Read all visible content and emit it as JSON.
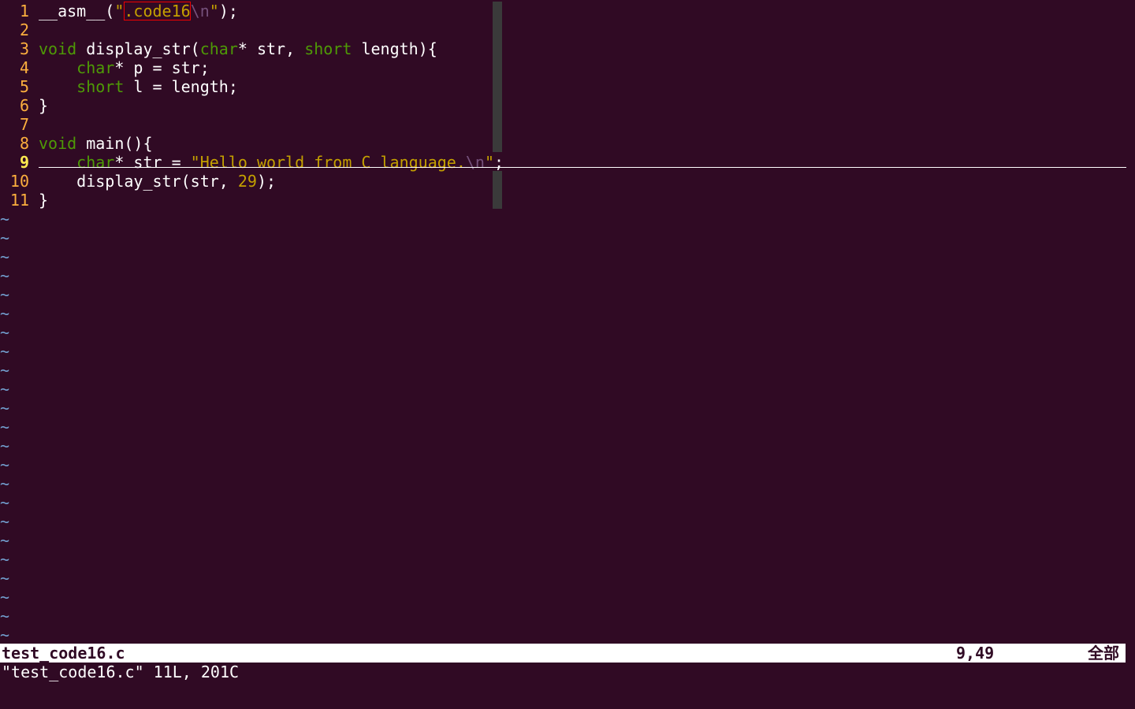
{
  "colors": {
    "background": "#300a24",
    "line_number": "#fcaf3e",
    "keyword": "#4e9a06",
    "string": "#c4a000",
    "escape": "#75507b",
    "tilde": "#729fcf",
    "statusbar_bg": "#ffffff"
  },
  "lines": [
    {
      "n": "1",
      "segs": [
        {
          "t": "__asm__(",
          "c": ""
        },
        {
          "t": "\"",
          "c": "str"
        },
        {
          "t": ".code16",
          "c": "str boxed"
        },
        {
          "t": "\\n",
          "c": "esc"
        },
        {
          "t": "\"",
          "c": "str"
        },
        {
          "t": ");",
          "c": ""
        }
      ]
    },
    {
      "n": "2",
      "segs": []
    },
    {
      "n": "3",
      "segs": [
        {
          "t": "void",
          "c": "kw"
        },
        {
          "t": " display_str(",
          "c": ""
        },
        {
          "t": "char",
          "c": "kw"
        },
        {
          "t": "* str, ",
          "c": ""
        },
        {
          "t": "short",
          "c": "kw"
        },
        {
          "t": " length){",
          "c": ""
        }
      ]
    },
    {
      "n": "4",
      "segs": [
        {
          "t": "    ",
          "c": ""
        },
        {
          "t": "char",
          "c": "kw"
        },
        {
          "t": "* p = str;",
          "c": ""
        }
      ]
    },
    {
      "n": "5",
      "segs": [
        {
          "t": "    ",
          "c": ""
        },
        {
          "t": "short",
          "c": "kw"
        },
        {
          "t": " l = length;",
          "c": ""
        }
      ]
    },
    {
      "n": "6",
      "segs": [
        {
          "t": "}",
          "c": ""
        }
      ]
    },
    {
      "n": "7",
      "segs": []
    },
    {
      "n": "8",
      "segs": [
        {
          "t": "void",
          "c": "kw"
        },
        {
          "t": " main(){",
          "c": ""
        }
      ]
    },
    {
      "n": "9",
      "current": true,
      "segs": [
        {
          "t": "    ",
          "c": ""
        },
        {
          "t": "char",
          "c": "kw"
        },
        {
          "t": "* str = ",
          "c": ""
        },
        {
          "t": "\"Hello world from C language.",
          "c": "str"
        },
        {
          "t": "\\n",
          "c": "esc"
        },
        {
          "t": "\"",
          "c": "str"
        },
        {
          "t": ";",
          "c": ""
        }
      ]
    },
    {
      "n": "10",
      "segs": [
        {
          "t": "    display_str(str, ",
          "c": ""
        },
        {
          "t": "29",
          "c": "num"
        },
        {
          "t": ");",
          "c": ""
        }
      ]
    },
    {
      "n": "11",
      "segs": [
        {
          "t": "}",
          "c": ""
        }
      ]
    }
  ],
  "tilde_char": "~",
  "tilde_count": 23,
  "statusbar": {
    "filename": "test_code16.c",
    "position": "9,49",
    "scroll": "全部"
  },
  "cmdline": "\"test_code16.c\" 11L, 201C"
}
